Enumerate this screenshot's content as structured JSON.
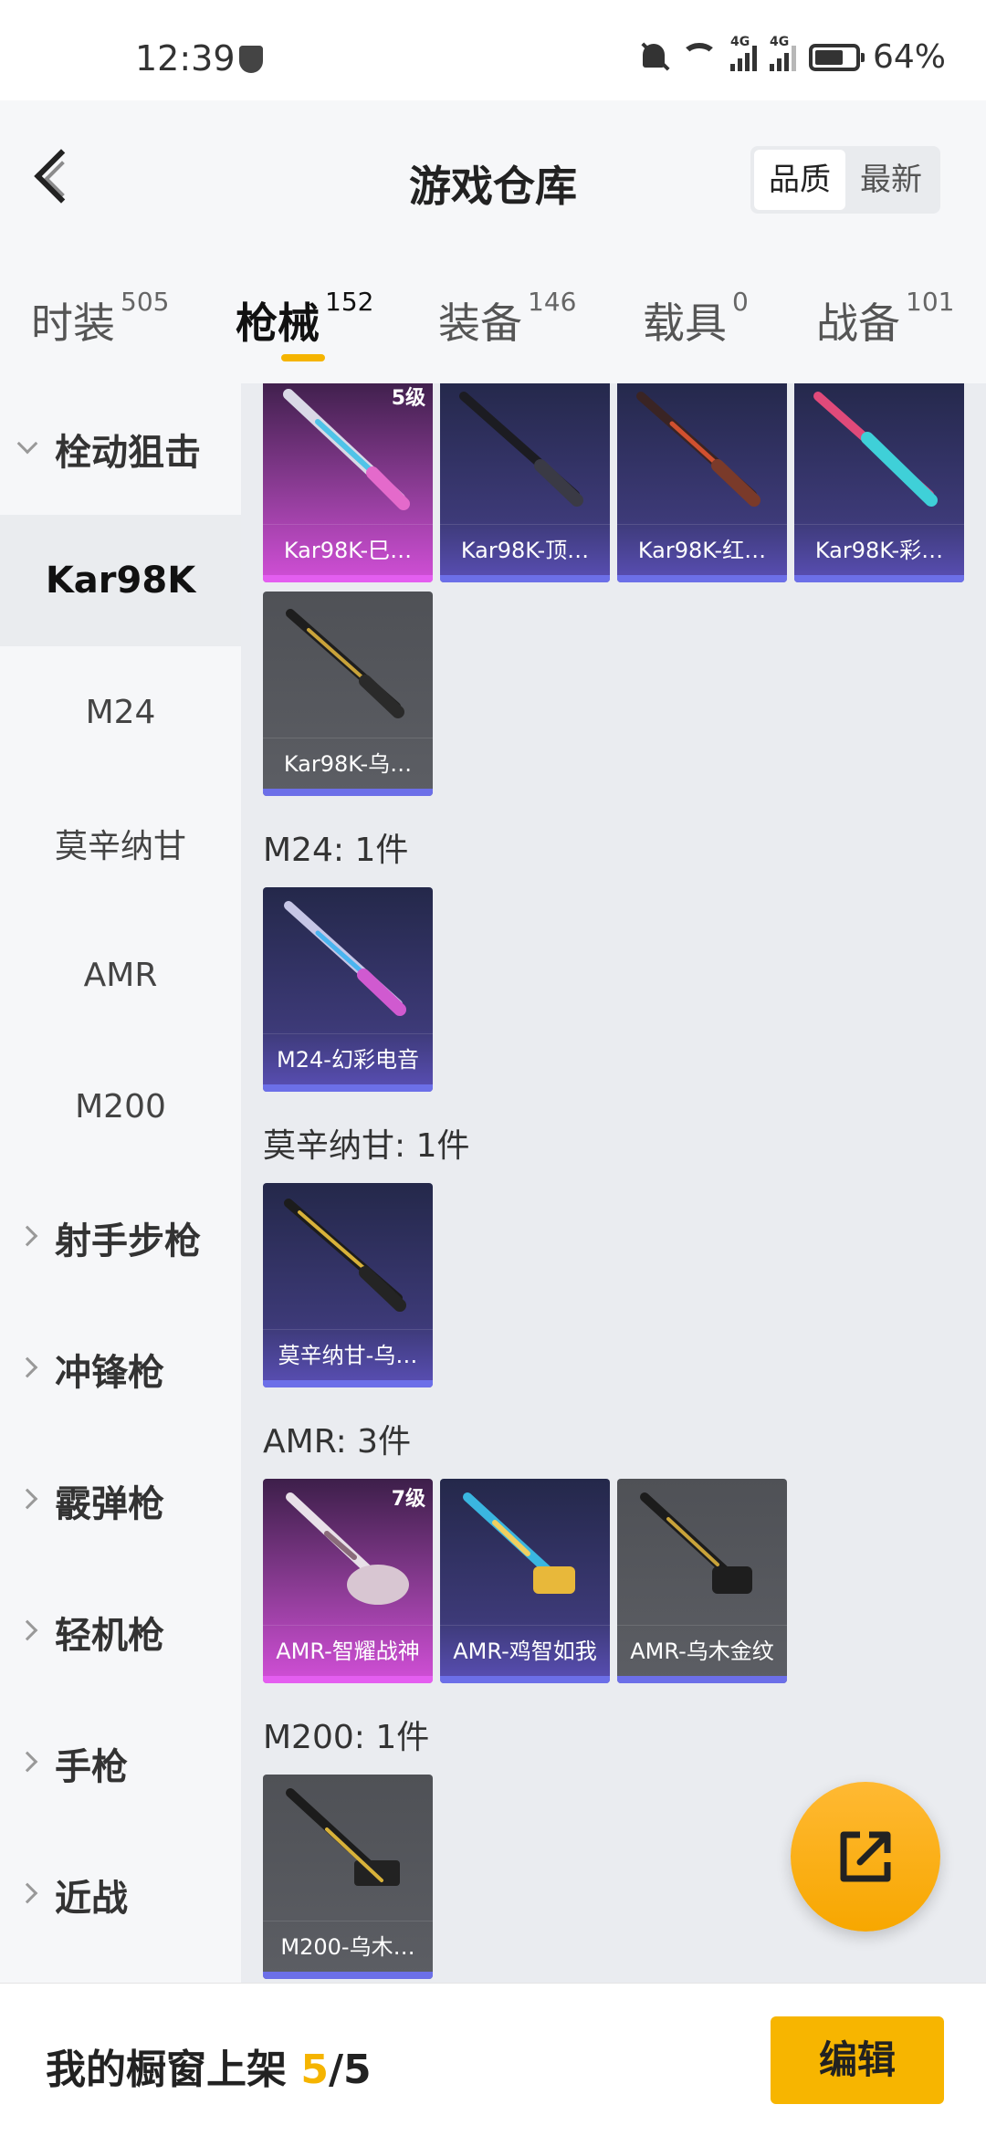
{
  "status_bar": {
    "time": "12:39",
    "network_1": "4G",
    "network_2": "4G",
    "battery": "64%"
  },
  "header": {
    "title": "游戏仓库",
    "sort_options": [
      "品质",
      "最新"
    ],
    "sort_active": "品质"
  },
  "tabs": [
    {
      "label": "时装",
      "count": "505"
    },
    {
      "label": "枪械",
      "count": "152"
    },
    {
      "label": "装备",
      "count": "146"
    },
    {
      "label": "载具",
      "count": "0"
    },
    {
      "label": "战备",
      "count": "101"
    }
  ],
  "active_tab": "枪械",
  "sidebar": {
    "group_open": "栓动狙击",
    "sub_items": [
      "Kar98K",
      "M24",
      "莫辛纳甘",
      "AMR",
      "M200"
    ],
    "active_sub": "Kar98K",
    "groups": [
      "射手步枪",
      "冲锋枪",
      "霰弹枪",
      "轻机枪",
      "手枪",
      "近战"
    ]
  },
  "sections": [
    {
      "title": "",
      "items": [
        {
          "name": "Kar98K-巳…",
          "level": "5级",
          "rarity": "pink"
        },
        {
          "name": "Kar98K-顶…",
          "level": "",
          "rarity": "purple"
        },
        {
          "name": "Kar98K-红…",
          "level": "",
          "rarity": "purple"
        },
        {
          "name": "Kar98K-彩…",
          "level": "",
          "rarity": "purple"
        },
        {
          "name": "Kar98K-乌…",
          "level": "",
          "rarity": "gray"
        }
      ]
    },
    {
      "title": "M24: 1件",
      "items": [
        {
          "name": "M24-幻彩电音",
          "level": "",
          "rarity": "purple"
        }
      ]
    },
    {
      "title": "莫辛纳甘: 1件",
      "items": [
        {
          "name": "莫辛纳甘-乌…",
          "level": "",
          "rarity": "purple"
        }
      ]
    },
    {
      "title": "AMR: 3件",
      "items": [
        {
          "name": "AMR-智耀战神",
          "level": "7级",
          "rarity": "pink"
        },
        {
          "name": "AMR-鸡智如我",
          "level": "",
          "rarity": "purple"
        },
        {
          "name": "AMR-乌木金纹",
          "level": "",
          "rarity": "gray"
        }
      ]
    },
    {
      "title": "M200: 1件",
      "items": [
        {
          "name": "M200-乌木…",
          "level": "",
          "rarity": "gray"
        }
      ]
    }
  ],
  "bottom_bar": {
    "text_prefix": "我的橱窗上架 ",
    "shown": "5",
    "text_sep": "/",
    "total": "5",
    "edit_label": "编辑"
  },
  "icons": {
    "fab": "share-export-icon",
    "back": "back-arrow-icon"
  },
  "colors": {
    "accent": "#f5b400",
    "purple_rarity": "#6c6fe8",
    "pink_rarity": "#e45ef0"
  }
}
